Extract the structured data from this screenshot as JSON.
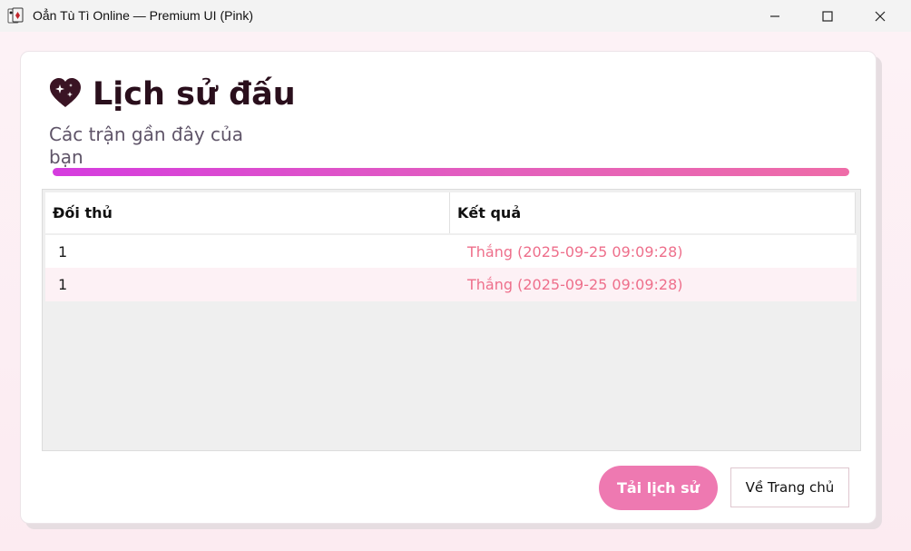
{
  "window": {
    "title": "Oẳn Tù Tì Online — Premium UI (Pink)",
    "app_icon": "playing-cards-icon",
    "controls": [
      "minimize-icon",
      "maximize-icon",
      "close-icon"
    ]
  },
  "page": {
    "heading_icon": "sparkling-heart-icon",
    "heading": "Lịch sử đấu",
    "subheading": "Các trận gần đây của bạn"
  },
  "history_table": {
    "columns": [
      "Đối thủ",
      "Kết quả"
    ],
    "rows": [
      {
        "opponent": "1",
        "result": "Thắng (2025-09-25 09:09:28)"
      },
      {
        "opponent": "1",
        "result": "Thắng (2025-09-25 09:09:28)"
      }
    ]
  },
  "actions": {
    "load_history": "Tải lịch sử",
    "back_home": "Về Trang chủ"
  },
  "colors": {
    "accent_start": "#d53cdf",
    "accent_end": "#ee6ca8",
    "win_result": "#ee6f8b",
    "primary_button": "#ee79b1",
    "heading": "#2a0f1c"
  }
}
